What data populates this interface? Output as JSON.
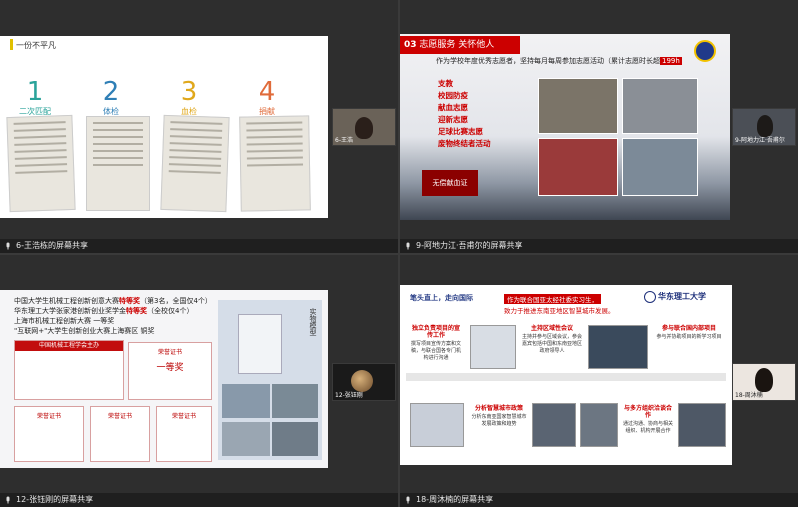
{
  "panes": {
    "p1": {
      "footer": "6-王浩栋的屏幕共享",
      "cam_label": "6-王浩",
      "slide": {
        "title": "一份不平凡",
        "steps": [
          {
            "num": "1",
            "label": "二次匹配",
            "color": "#2aa39a"
          },
          {
            "num": "2",
            "label": "体检",
            "color": "#2f7fb6"
          },
          {
            "num": "3",
            "label": "血检",
            "color": "#e0a81c"
          },
          {
            "num": "4",
            "label": "捐献",
            "color": "#e06b3a"
          }
        ]
      }
    },
    "p2": {
      "footer": "9-阿地力江·吾甫尔的屏幕共享",
      "cam_label": "9-阿地力江·吾甫尔",
      "slide": {
        "banner_num": "03",
        "banner_text": "志愿服务 关怀他人",
        "intro": "作为学校年度优秀志愿者，坚持每月每周参加志愿活动（累计志愿时长超",
        "intro_hl": "199h",
        "items": [
          "支教",
          "校园防疫",
          "献血志愿",
          "迎新志愿",
          "足球比赛志愿",
          "废物终结者活动"
        ],
        "seal": "无偿献血证"
      }
    },
    "p3": {
      "footer": "12-张钰刚的屏幕共享",
      "cam_label": "12-张钰刚",
      "slide": {
        "line1_a": "中国大学生机械工程创新创意大赛",
        "line1_b": "特等奖",
        "line1_c": "（第3名，全国仅4个）",
        "line2_a": "华东理工大学张家港创新创业奖学金",
        "line2_b": "特等奖",
        "line2_c": "（全校仅4个）",
        "line3": "上海市机械工程创新大赛 一等奖",
        "line4": "\"互联网+\"大学生创新创业大赛上海赛区 铜奖",
        "cert_org": "中国机械工程学会主办",
        "cert_hon": "荣誉证书",
        "cert_prize": "一等奖",
        "side_caption": "实物模型"
      }
    },
    "p4": {
      "footer": "18-周沐楠的屏幕共享",
      "cam_label": "18-周沐楠",
      "slide": {
        "heading": "笔头直上，走向国际",
        "tag": "作为联合国亚太经社委实习生，",
        "tag2": "致力于推进东南亚地区智慧城市发展。",
        "brand": "华东理工大学",
        "boxes": [
          {
            "title": "独立负责项目的宣传工作",
            "text": "撰写项目宣传方案和文稿，与联合国各专门机构进行沟通"
          },
          {
            "title": "主持区域性会议",
            "text": "主持并参与区域会议，参会嘉宾包括中国和东南亚地区政府领导人"
          },
          {
            "title": "参与联合国内部项目",
            "text": "参与并协助项目的新学习项目"
          },
          {
            "title": "分析智慧城市政策",
            "text": "分析东南亚国家智慧城市发展政策和趋势"
          },
          {
            "title": "与多方组织洽谈合作",
            "text": "通过沟通、协商与相关组织、机构开展合作"
          }
        ]
      }
    }
  }
}
